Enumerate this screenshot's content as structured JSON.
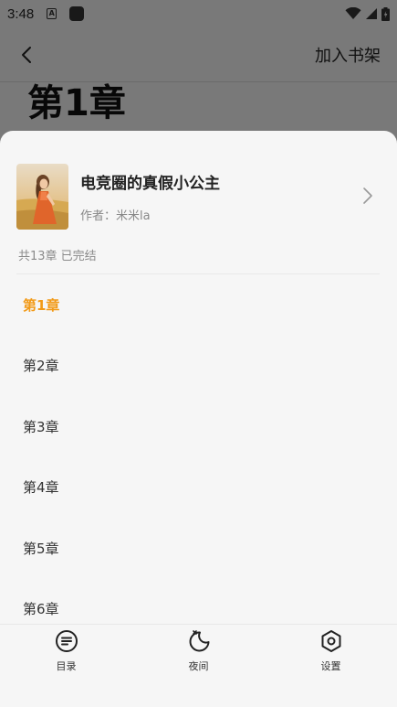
{
  "status_bar": {
    "time": "3:48",
    "badge_letter": "A"
  },
  "top_bar": {
    "action_label": "加入书架"
  },
  "reader": {
    "chapter_heading": "第1章"
  },
  "book": {
    "title": "电竞圈的真假小公主",
    "author": "作者：米米la",
    "chapter_summary": "共13章 已完结"
  },
  "chapters": [
    "第1章",
    "第2章",
    "第3章",
    "第4章",
    "第5章",
    "第6章"
  ],
  "active_chapter_index": 0,
  "bottom_nav": {
    "catalog": "目录",
    "night": "夜间",
    "settings": "设置"
  },
  "colors": {
    "accent": "#f29a17"
  },
  "icons": [
    "back-arrow-icon",
    "chevron-right-icon",
    "catalog-icon",
    "night-moon-icon",
    "settings-hexagon-icon",
    "wifi-icon",
    "signal-icon",
    "battery-icon"
  ]
}
